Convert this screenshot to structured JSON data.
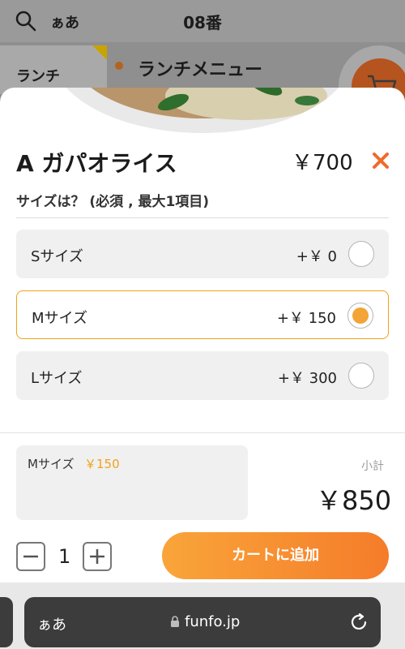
{
  "background": {
    "search_icon": "search-icon",
    "lang_toggle": "ぁあ",
    "table_number": "08番",
    "category": "ランチ",
    "menu_title": "ランチメニュー",
    "cart_icon": "cart-icon"
  },
  "item": {
    "name": "A ガパオライス",
    "price": "￥700",
    "close_icon": "close-icon"
  },
  "option_group": {
    "question": "サイズは？ (必須 , 最大1項目)",
    "options": [
      {
        "label": "Sサイズ",
        "price": "+￥ 0",
        "selected": false
      },
      {
        "label": "Mサイズ",
        "price": "+￥ 150",
        "selected": true
      },
      {
        "label": "Lサイズ",
        "price": "+￥ 300",
        "selected": false
      }
    ]
  },
  "summary": {
    "selected_label": "Mサイズ",
    "selected_price": "￥150",
    "subtotal_label": "小計",
    "subtotal": "￥850"
  },
  "quantity": {
    "value": "1",
    "minus_icon": "minus-icon",
    "plus_icon": "plus-icon"
  },
  "add_to_cart": "カートに追加",
  "browser": {
    "text_size": "ぁあ",
    "url": "funfo.jp",
    "lock_icon": "lock-icon",
    "reload_icon": "reload-icon"
  },
  "colors": {
    "accent": "#f0a21a",
    "button_start": "#f9a53a",
    "button_end": "#f57c2a",
    "close": "#f06a2a"
  }
}
